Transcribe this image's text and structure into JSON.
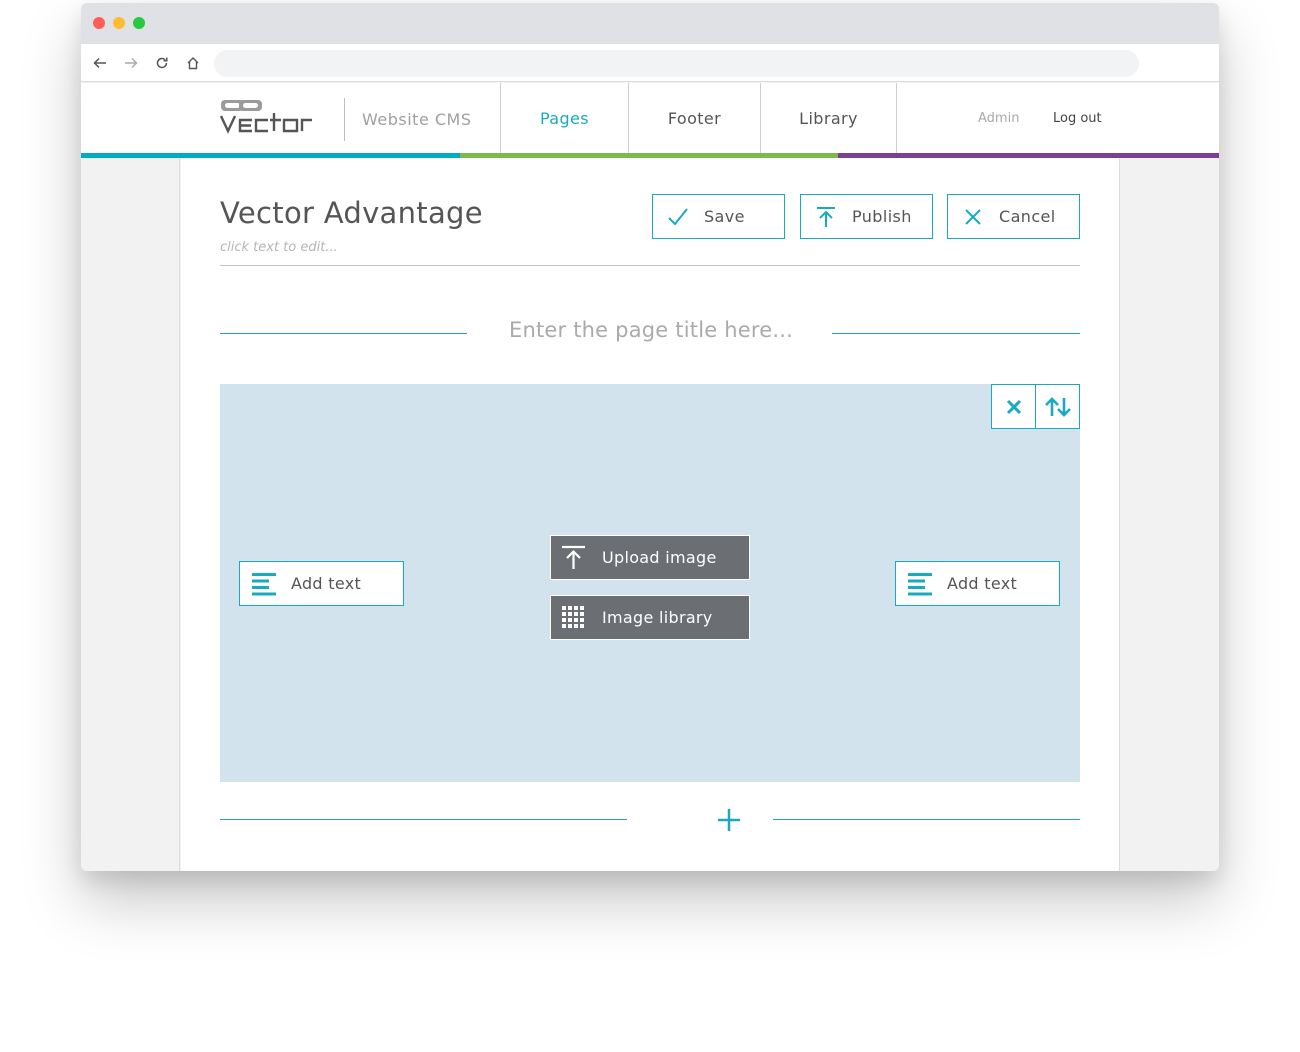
{
  "browser": {
    "traffic_lights": [
      "close",
      "minimize",
      "maximize"
    ],
    "nav_icons": [
      "back-arrow-icon",
      "forward-arrow-icon",
      "reload-icon",
      "home-icon"
    ],
    "url": ""
  },
  "header": {
    "logo_text": "vector",
    "app_name": "Website CMS",
    "tabs": [
      {
        "label": "Pages",
        "active": true
      },
      {
        "label": "Footer",
        "active": false
      },
      {
        "label": "Library",
        "active": false
      }
    ],
    "user_label": "Admin",
    "logout_label": "Log out",
    "accent_colors": {
      "teal": "#00acc1",
      "green": "#7cbb4a",
      "purple": "#7b3f96"
    }
  },
  "editor": {
    "page_name": "Vector Advantage",
    "hint": "click text to edit...",
    "actions": {
      "save": "Save",
      "publish": "Publish",
      "cancel": "Cancel"
    },
    "section_title_placeholder": "Enter the page title here...",
    "block": {
      "controls": [
        "remove-icon",
        "reorder-icon"
      ],
      "left_add_text": "Add text",
      "right_add_text": "Add text",
      "upload_image": "Upload image",
      "image_library": "Image library"
    },
    "add_block_icon": "plus-icon"
  }
}
